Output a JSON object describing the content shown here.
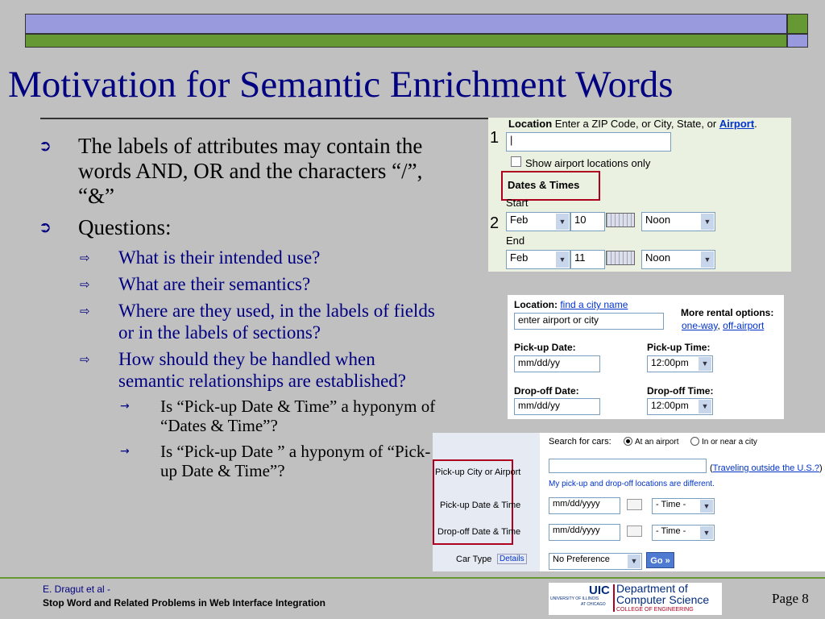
{
  "slide": {
    "title": "Motivation for Semantic Enrichment Words",
    "bullets": {
      "b1": "The labels of attributes may contain the words AND, OR and the characters “/”, “&”",
      "b2": "Questions:",
      "q1": "What is their intended use?",
      "q2": "What are their semantics?",
      "q3": "Where are they used, in the labels of fields or in the labels of sections?",
      "q4": "How should they be handled when semantic relationships are established?",
      "s1": "Is “Pick-up Date & Time” a hyponym of “Dates & Time”?",
      "s2": "Is “Pick-up Date ” a hyponym of “Pick-up Date & Time”?"
    }
  },
  "form1": {
    "location_label": "Location",
    "location_hint": "Enter a ZIP Code, or City, State, or",
    "airport_link": "Airport",
    "period": ".",
    "num1": "1",
    "num2": "2",
    "show_airport": "Show airport locations only",
    "section": "Dates & Times",
    "start": "Start",
    "end": "End",
    "start_month": "Feb",
    "start_day": "10",
    "start_time": "Noon",
    "end_month": "Feb",
    "end_day": "11",
    "end_time": "Noon"
  },
  "form2": {
    "location_label": "Location:",
    "find_city": "find a city name",
    "location_value": "enter airport or city",
    "more_options": "More rental options:",
    "one_way": "one-way",
    "comma": ",",
    "off_airport": "off-airport",
    "pickup_date": "Pick-up Date:",
    "pickup_time": "Pick-up Time:",
    "date_value1": "mm/dd/yy",
    "time_value1": "12:00pm",
    "dropoff_date": "Drop-off Date:",
    "dropoff_time": "Drop-off Time:",
    "date_value2": "mm/dd/yy",
    "time_value2": "12:00pm"
  },
  "form3": {
    "search_for": "Search for cars:",
    "at_airport": "At an airport",
    "in_city": "In or near a city",
    "pickup_city": "Pick-up City or Airport",
    "traveling": "Traveling outside the U.S.?",
    "different": "My pick-up and drop-off locations are different.",
    "pickup_dt": "Pick-up Date & Time",
    "dropoff_dt": "Drop-off Date & Time",
    "date1": "mm/dd/yyyy",
    "date2": "mm/dd/yyyy",
    "time1": "- Time -",
    "time2": "- Time -",
    "car_type": "Car Type",
    "details": "Details",
    "preference": "No Preference",
    "go": "Go »"
  },
  "footer": {
    "author": "E. Dragut et al -",
    "paper": "Stop Word and Related Problems in Web Interface Integration",
    "logo_uic": "UIC",
    "logo_univ1": "UNIVERSITY OF ILLINOIS",
    "logo_univ2": "AT CHICAGO",
    "logo_dept1": "Department of",
    "logo_dept2": "Computer Science",
    "logo_college": "COLLEGE OF ENGINEERING",
    "page": "Page 8"
  }
}
